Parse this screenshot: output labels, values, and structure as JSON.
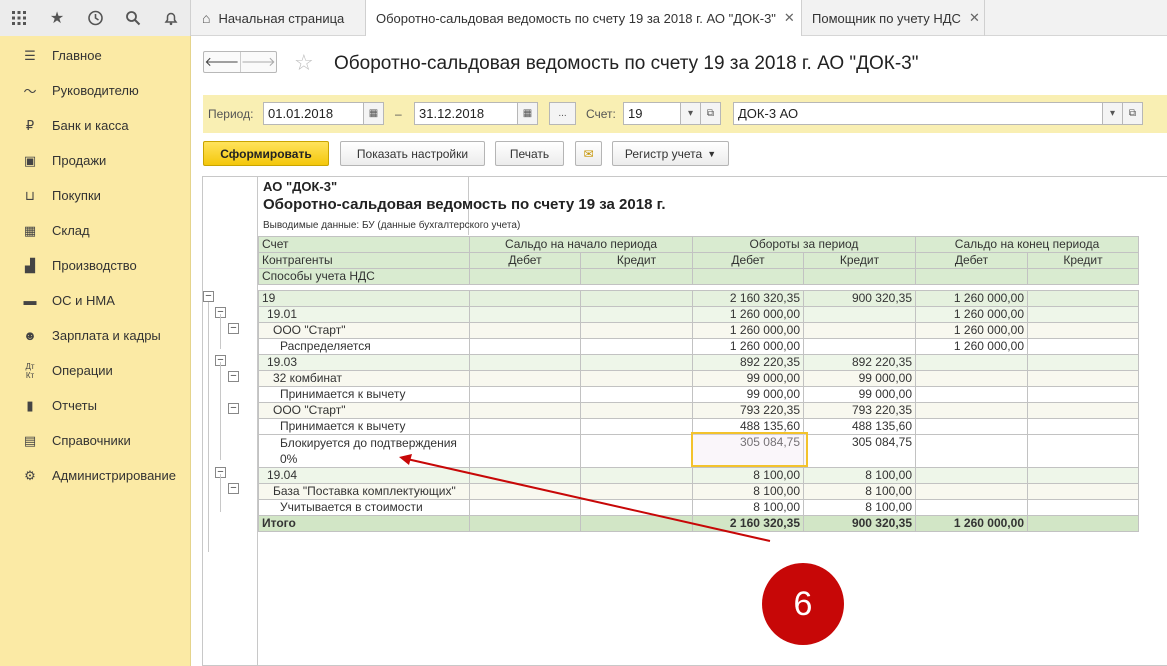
{
  "tabs": [
    {
      "label": "Начальная страница"
    },
    {
      "label": "Оборотно-сальдовая ведомость по счету 19 за 2018 г. АО \"ДОК-3\""
    },
    {
      "label": "Помощник по учету НДС"
    }
  ],
  "sidebar": {
    "items": [
      {
        "label": "Главное",
        "icon": "menu-icon"
      },
      {
        "label": "Руководителю",
        "icon": "chart-line-icon"
      },
      {
        "label": "Банк и касса",
        "icon": "ruble-icon"
      },
      {
        "label": "Продажи",
        "icon": "shopping-bag-icon"
      },
      {
        "label": "Покупки",
        "icon": "cart-icon"
      },
      {
        "label": "Склад",
        "icon": "warehouse-icon"
      },
      {
        "label": "Производство",
        "icon": "factory-icon"
      },
      {
        "label": "ОС и НМА",
        "icon": "truck-icon"
      },
      {
        "label": "Зарплата и кадры",
        "icon": "people-icon"
      },
      {
        "label": "Операции",
        "icon": "dt-kt-icon"
      },
      {
        "label": "Отчеты",
        "icon": "bar-chart-icon"
      },
      {
        "label": "Справочники",
        "icon": "book-icon"
      },
      {
        "label": "Администрирование",
        "icon": "gear-icon"
      }
    ]
  },
  "page": {
    "title": "Оборотно-сальдовая ведомость по счету 19 за 2018 г. АО \"ДОК-3\""
  },
  "filters": {
    "period_label": "Период:",
    "date_from": "01.01.2018",
    "dash": "–",
    "date_to": "31.12.2018",
    "more": "...",
    "account_label": "Счет:",
    "account": "19",
    "organization": "ДОК-3 АО"
  },
  "toolbar": {
    "generate": "Сформировать",
    "show_settings": "Показать настройки",
    "print": "Печать",
    "register": "Регистр учета"
  },
  "report": {
    "org": "АО \"ДОК-3\"",
    "title": "Оборотно-сальдовая ведомость по счету 19 за 2018 г.",
    "output": "Выводимые данные:  БУ (данные бухгалтерского учета)",
    "headers": {
      "account": "Счет",
      "contractors": "Контрагенты",
      "vat_methods": "Способы учета НДС",
      "start": "Сальдо на начало периода",
      "turnover": "Обороты за период",
      "end": "Сальдо на конец периода",
      "debit": "Дебет",
      "credit": "Кредит"
    },
    "rows": [
      {
        "name": "19",
        "sd": "",
        "sk": "",
        "od": "2 160 320,35",
        "ok": "900 320,35",
        "ed": "1 260 000,00",
        "ek": ""
      },
      {
        "name": "19.01",
        "sd": "",
        "sk": "",
        "od": "1 260 000,00",
        "ok": "",
        "ed": "1 260 000,00",
        "ek": ""
      },
      {
        "name": "ООО \"Старт\"",
        "sd": "",
        "sk": "",
        "od": "1 260 000,00",
        "ok": "",
        "ed": "1 260 000,00",
        "ek": ""
      },
      {
        "name": "Распределяется",
        "sd": "",
        "sk": "",
        "od": "1 260 000,00",
        "ok": "",
        "ed": "1 260 000,00",
        "ek": ""
      },
      {
        "name": "19.03",
        "sd": "",
        "sk": "",
        "od": "892 220,35",
        "ok": "892 220,35",
        "ed": "",
        "ek": ""
      },
      {
        "name": "32 комбинат",
        "sd": "",
        "sk": "",
        "od": "99 000,00",
        "ok": "99 000,00",
        "ed": "",
        "ek": ""
      },
      {
        "name": "Принимается к вычету",
        "sd": "",
        "sk": "",
        "od": "99 000,00",
        "ok": "99 000,00",
        "ed": "",
        "ek": ""
      },
      {
        "name": "ООО \"Старт\"",
        "sd": "",
        "sk": "",
        "od": "793 220,35",
        "ok": "793 220,35",
        "ed": "",
        "ek": ""
      },
      {
        "name": "Принимается к вычету",
        "sd": "",
        "sk": "",
        "od": "488 135,60",
        "ok": "488 135,60",
        "ed": "",
        "ek": ""
      },
      {
        "name": "Блокируется до подтверждения",
        "name2": "0%",
        "sd": "",
        "sk": "",
        "od": "305 084,75",
        "ok": "305 084,75",
        "ed": "",
        "ek": ""
      },
      {
        "name": "19.04",
        "sd": "",
        "sk": "",
        "od": "8 100,00",
        "ok": "8 100,00",
        "ed": "",
        "ek": ""
      },
      {
        "name": "База \"Поставка комплектующих\"",
        "sd": "",
        "sk": "",
        "od": "8 100,00",
        "ok": "8 100,00",
        "ed": "",
        "ek": ""
      },
      {
        "name": "Учитывается в стоимости",
        "sd": "",
        "sk": "",
        "od": "8 100,00",
        "ok": "8 100,00",
        "ed": "",
        "ek": ""
      }
    ],
    "total": {
      "name": "Итого",
      "sd": "",
      "sk": "",
      "od": "2 160 320,35",
      "ok": "900 320,35",
      "ed": "1 260 000,00",
      "ek": ""
    }
  },
  "annotation": {
    "number": "6",
    "color": "#c70707"
  }
}
